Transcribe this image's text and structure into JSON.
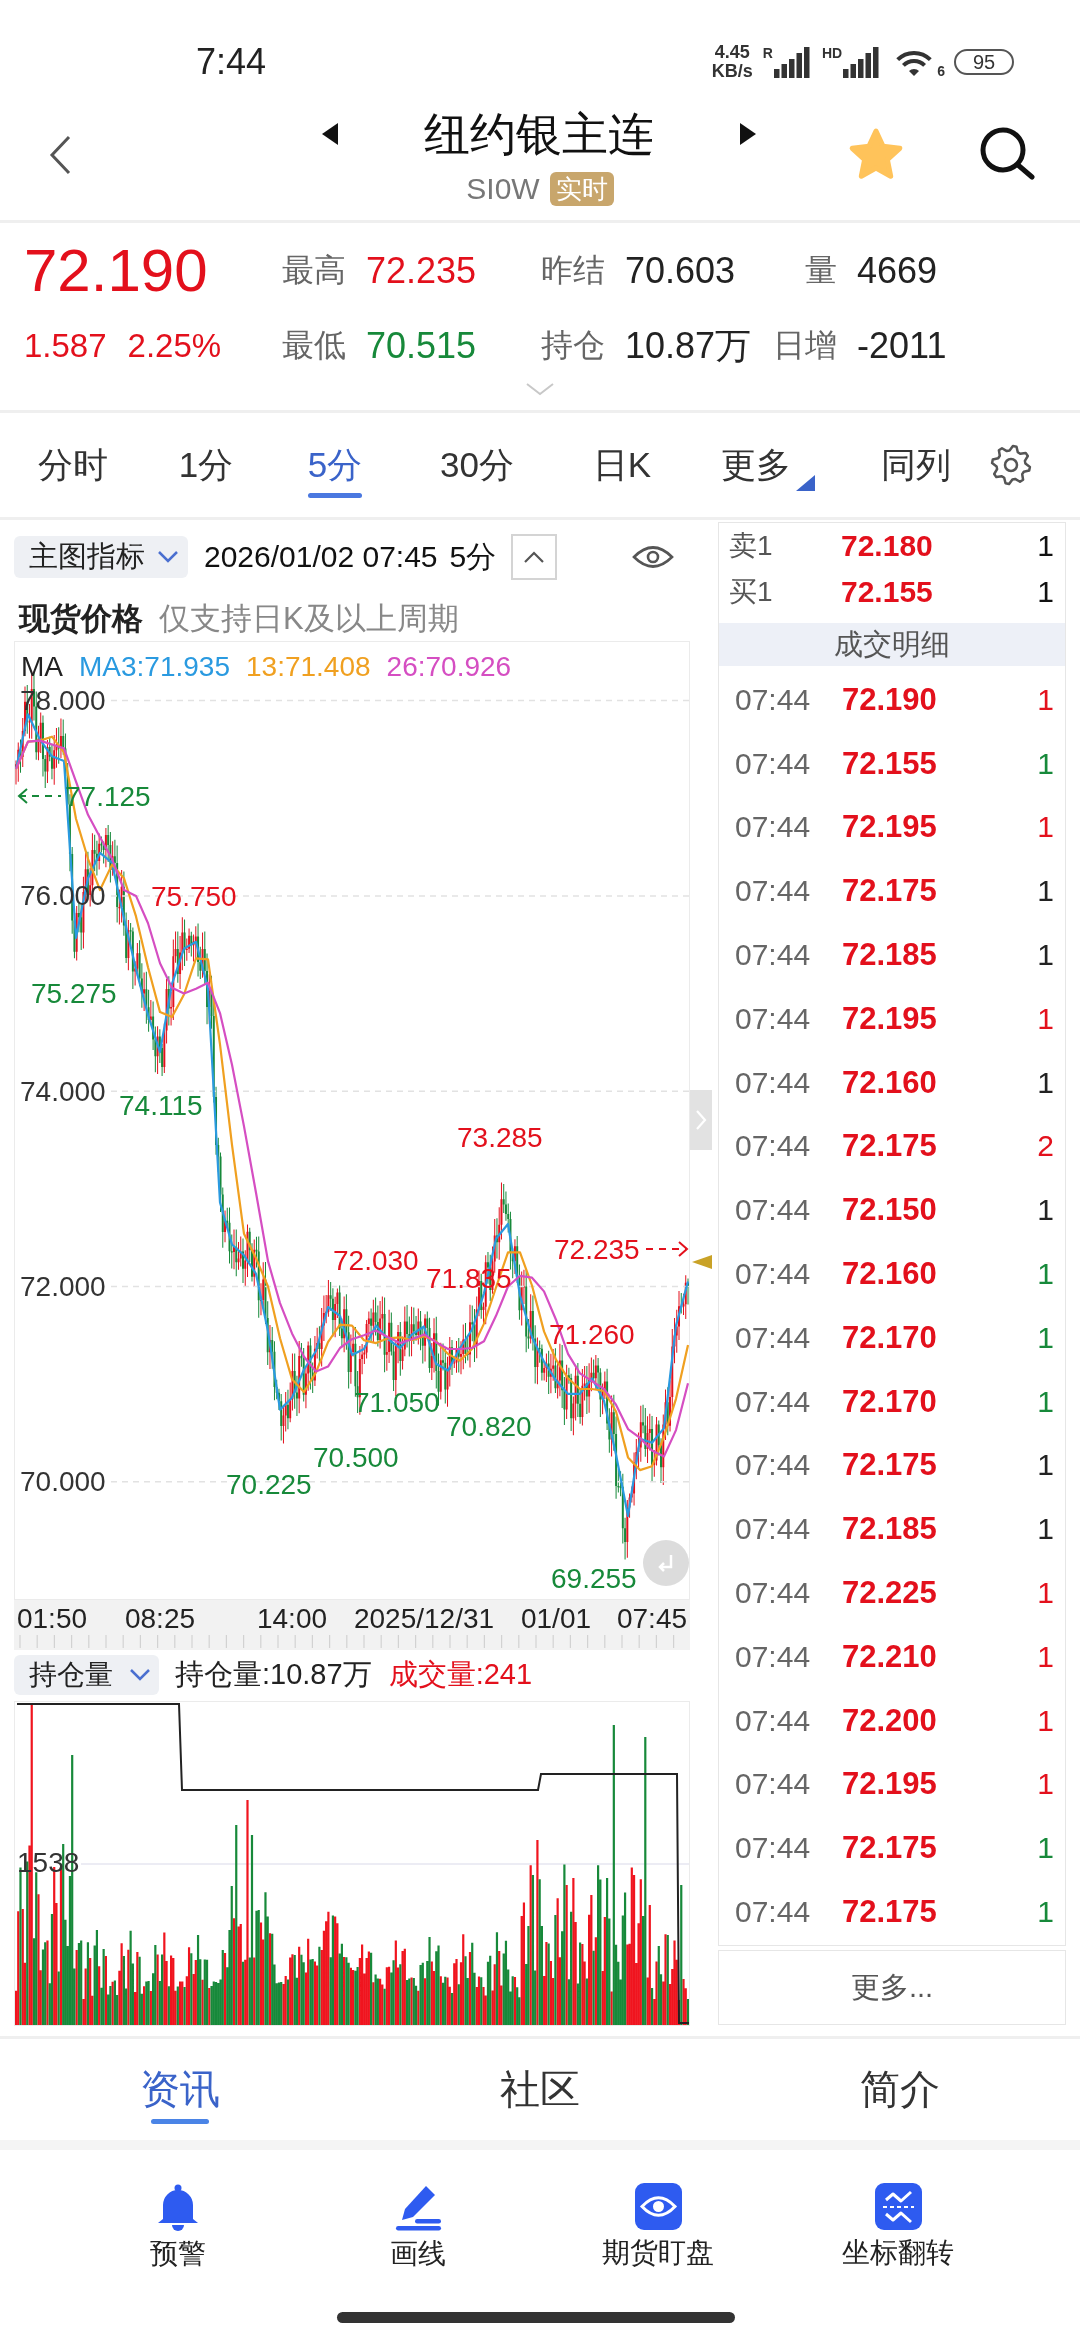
{
  "status_bar": {
    "time": "7:44",
    "network_speed": "4.45",
    "network_unit": "KB/s",
    "sim_labels": [
      "R",
      "HD"
    ],
    "wifi_label": "6",
    "battery": "95"
  },
  "header": {
    "title": "纽约银主连",
    "code": "SI0W",
    "badge": "实时",
    "favorite": true
  },
  "quote": {
    "price": "72.190",
    "rising": true,
    "change": "1.587",
    "change_percent": "2.25%",
    "stats": [
      {
        "label": "最高",
        "value": "72.235",
        "color": "#e3101c"
      },
      {
        "label": "昨结",
        "value": "70.603",
        "color": "#222222"
      },
      {
        "label": "量",
        "value": "4669",
        "color": "#222222"
      },
      {
        "label": "最低",
        "value": "70.515",
        "color": "#17893a"
      },
      {
        "label": "持仓",
        "value": "10.87万",
        "color": "#222222"
      },
      {
        "label": "日增",
        "value": "-2011",
        "color": "#222222"
      }
    ]
  },
  "period_tabs": [
    {
      "label": "分时",
      "selected": false,
      "kind": "period"
    },
    {
      "label": "1分",
      "selected": false,
      "kind": "period"
    },
    {
      "label": "5分",
      "selected": true,
      "kind": "period"
    },
    {
      "label": "30分",
      "selected": false,
      "kind": "period"
    },
    {
      "label": "日K",
      "selected": false,
      "kind": "period"
    },
    {
      "label": "更多",
      "selected": false,
      "kind": "menu"
    },
    {
      "label": "同列",
      "selected": false,
      "kind": "period"
    }
  ],
  "chart": {
    "indicator": "主图指标",
    "timestamp": "2026/01/02 07:45",
    "period": "5分",
    "note_title": "现货价格",
    "note": "仅支持日K及以上周期",
    "legend_title": "MA",
    "chart_data": {
      "type": "line",
      "grid": true,
      "categories": [
        null,
        null,
        null,
        "01:50",
        null,
        null,
        null,
        null,
        null,
        null,
        null,
        null,
        "08:25",
        null,
        null,
        null,
        null,
        null,
        null,
        null,
        null,
        null,
        null,
        "14:00",
        null,
        null,
        null,
        null,
        null,
        null,
        null,
        null,
        null,
        null,
        "2025/12/31",
        null,
        null,
        null,
        null,
        null,
        null,
        null,
        null,
        null,
        null,
        "01/01",
        null,
        null,
        null,
        null,
        null,
        null,
        null,
        "07:45",
        null,
        null,
        null
      ],
      "ylim": [
        68.8,
        78.6
      ],
      "yticks": [
        {
          "value": 78,
          "label": "78.000"
        },
        {
          "value": 76,
          "label": "76.000"
        },
        {
          "value": 74,
          "label": "74.000"
        },
        {
          "value": 72,
          "label": "72.000"
        },
        {
          "value": 70,
          "label": "70.000"
        }
      ],
      "series": [
        {
          "name": "MA3:71.935",
          "color": "#2a9ae0",
          "values": [
            77.3,
            77.86,
            77.6,
            77.43,
            77.38,
            75.57,
            76.18,
            76.44,
            76.34,
            75.77,
            75.25,
            74.78,
            74.4,
            75.1,
            75.46,
            75.53,
            75.05,
            72.86,
            72.43,
            72.32,
            72.13,
            71.54,
            70.74,
            70.86,
            71.15,
            71.34,
            71.79,
            71.7,
            71.3,
            71.36,
            71.6,
            71.46,
            71.37,
            71.51,
            71.59,
            71.21,
            71.14,
            71.37,
            71.56,
            71.93,
            72.49,
            72.64,
            71.91,
            71.48,
            71.23,
            71.04,
            70.9,
            70.9,
            71.06,
            70.83,
            70.28,
            69.65,
            70.44,
            70.4,
            70.55,
            71.6,
            72.05
          ]
        },
        {
          "name": "13:71.408",
          "color": "#f0a020",
          "values": [
            77.3,
            77.58,
            77.59,
            77.63,
            77.47,
            76.79,
            76.38,
            76.06,
            76.32,
            76.18,
            75.79,
            75.27,
            74.81,
            74.76,
            74.99,
            75.36,
            75.35,
            74.48,
            73.45,
            72.54,
            72.29,
            72.0,
            71.47,
            71.05,
            70.92,
            71.12,
            71.43,
            71.61,
            71.6,
            71.45,
            71.42,
            71.47,
            71.48,
            71.45,
            71.49,
            71.44,
            71.31,
            71.24,
            71.36,
            71.62,
            71.99,
            72.35,
            72.35,
            72.01,
            71.54,
            71.25,
            71.06,
            70.95,
            70.95,
            70.93,
            70.72,
            70.25,
            70.12,
            70.16,
            70.46,
            70.85,
            71.4
          ]
        },
        {
          "name": "26:70.926",
          "color": "#d54ec2",
          "values": [
            77.3,
            77.58,
            77.59,
            77.55,
            77.51,
            77.17,
            76.83,
            76.6,
            76.38,
            76.06,
            76.0,
            75.72,
            75.31,
            75.06,
            75.0,
            75.05,
            75.11,
            74.8,
            74.27,
            73.64,
            72.96,
            72.26,
            71.83,
            71.52,
            71.28,
            71.13,
            71.18,
            71.37,
            71.46,
            71.5,
            71.55,
            71.48,
            71.42,
            71.46,
            71.51,
            71.43,
            71.36,
            71.36,
            71.37,
            71.44,
            71.7,
            72.0,
            72.11,
            72.09,
            71.95,
            71.66,
            71.31,
            71.11,
            71.03,
            70.95,
            70.79,
            70.54,
            70.45,
            70.32,
            70.26,
            70.53,
            71.01
          ]
        }
      ]
    },
    "markers": [
      {
        "text": "77.125",
        "color": "#17893a",
        "kind": "leftward"
      },
      {
        "text": "75.750",
        "color": "#e3101c",
        "kind": "plain"
      },
      {
        "text": "75.275",
        "color": "#17893a",
        "kind": "plain"
      },
      {
        "text": "74.115",
        "color": "#17893a",
        "kind": "plain"
      },
      {
        "text": "73.285",
        "color": "#e3101c",
        "kind": "plain"
      },
      {
        "text": "72.235",
        "color": "#e3101c",
        "kind": "rightward"
      },
      {
        "text": "72.030",
        "color": "#e3101c",
        "kind": "plain"
      },
      {
        "text": "71.835",
        "color": "#e3101c",
        "kind": "plain"
      },
      {
        "text": "71.260",
        "color": "#e3101c",
        "kind": "plain"
      },
      {
        "text": "71.050",
        "color": "#17893a",
        "kind": "plain"
      },
      {
        "text": "70.820",
        "color": "#17893a",
        "kind": "plain"
      },
      {
        "text": "70.500",
        "color": "#17893a",
        "kind": "plain"
      },
      {
        "text": "70.225",
        "color": "#17893a",
        "kind": "plain"
      },
      {
        "text": "69.255",
        "color": "#17893a",
        "kind": "plain"
      }
    ]
  },
  "volume_panel": {
    "indicator": "持仓量",
    "open_interest": "持仓量:10.87万",
    "volume": "成交量:241",
    "y_tick": "1538"
  },
  "order_book": {
    "levels": [
      {
        "label": "卖1",
        "price": "72.180",
        "volume": "1"
      },
      {
        "label": "买1",
        "price": "72.155",
        "volume": "1"
      }
    ],
    "trades_title": "成交明细",
    "trades": [
      {
        "time": "07:44",
        "price": "72.190",
        "volume": "1",
        "color": "#e3101c"
      },
      {
        "time": "07:44",
        "price": "72.155",
        "volume": "1",
        "color": "#17893a"
      },
      {
        "time": "07:44",
        "price": "72.195",
        "volume": "1",
        "color": "#e3101c"
      },
      {
        "time": "07:44",
        "price": "72.175",
        "volume": "1",
        "color": "#222222"
      },
      {
        "time": "07:44",
        "price": "72.185",
        "volume": "1",
        "color": "#222222"
      },
      {
        "time": "07:44",
        "price": "72.195",
        "volume": "1",
        "color": "#e3101c"
      },
      {
        "time": "07:44",
        "price": "72.160",
        "volume": "1",
        "color": "#222222"
      },
      {
        "time": "07:44",
        "price": "72.175",
        "volume": "2",
        "color": "#e3101c"
      },
      {
        "time": "07:44",
        "price": "72.150",
        "volume": "1",
        "color": "#222222"
      },
      {
        "time": "07:44",
        "price": "72.160",
        "volume": "1",
        "color": "#17893a"
      },
      {
        "time": "07:44",
        "price": "72.170",
        "volume": "1",
        "color": "#17893a"
      },
      {
        "time": "07:44",
        "price": "72.170",
        "volume": "1",
        "color": "#17893a"
      },
      {
        "time": "07:44",
        "price": "72.175",
        "volume": "1",
        "color": "#222222"
      },
      {
        "time": "07:44",
        "price": "72.185",
        "volume": "1",
        "color": "#222222"
      },
      {
        "time": "07:44",
        "price": "72.225",
        "volume": "1",
        "color": "#e3101c"
      },
      {
        "time": "07:44",
        "price": "72.210",
        "volume": "1",
        "color": "#e3101c"
      },
      {
        "time": "07:44",
        "price": "72.200",
        "volume": "1",
        "color": "#e3101c"
      },
      {
        "time": "07:44",
        "price": "72.195",
        "volume": "1",
        "color": "#e3101c"
      },
      {
        "time": "07:44",
        "price": "72.175",
        "volume": "1",
        "color": "#17893a"
      },
      {
        "time": "07:44",
        "price": "72.175",
        "volume": "1",
        "color": "#17893a"
      }
    ],
    "more": "更多..."
  },
  "info_tabs": [
    {
      "label": "资讯",
      "selected": true
    },
    {
      "label": "社区",
      "selected": false
    },
    {
      "label": "简介",
      "selected": false
    }
  ],
  "toolbar": [
    "预警",
    "画线",
    "期货盯盘",
    "坐标翻转"
  ]
}
